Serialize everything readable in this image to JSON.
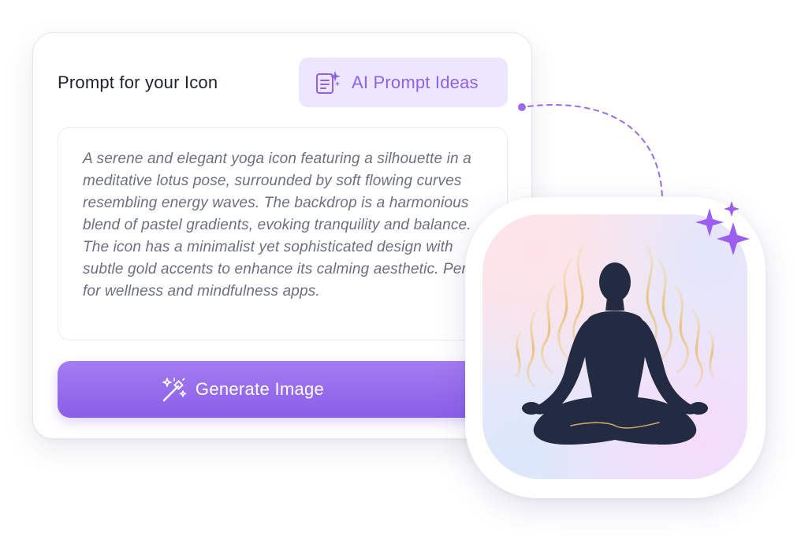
{
  "card": {
    "title": "Prompt for your Icon",
    "ideas_button_label": "AI Prompt Ideas",
    "ideas_icon": "sparkle-document-icon",
    "prompt_text": "A serene and elegant yoga icon featuring a silhouette in a meditative lotus pose, surrounded by soft flowing curves resembling energy waves. The backdrop is a harmonious blend of pastel gradients, evoking tranquility and balance. The icon has a minimalist yet sophisticated design with subtle gold accents to enhance its calming aesthetic. Perfect for wellness and mindfulness apps.",
    "generate_button_label": "Generate Image",
    "generate_icon": "magic-wand-icon"
  },
  "result": {
    "subject": "yoga-meditation-icon",
    "sparkle_icon": "sparkles-icon"
  },
  "colors": {
    "accent": "#8f61e6",
    "accent_light": "#ede6ff",
    "button_gradient_top": "#a47cf2",
    "button_gradient_bottom": "#8a5fe8",
    "figure": "#232b43",
    "gold_accent": "#e9c27a"
  }
}
